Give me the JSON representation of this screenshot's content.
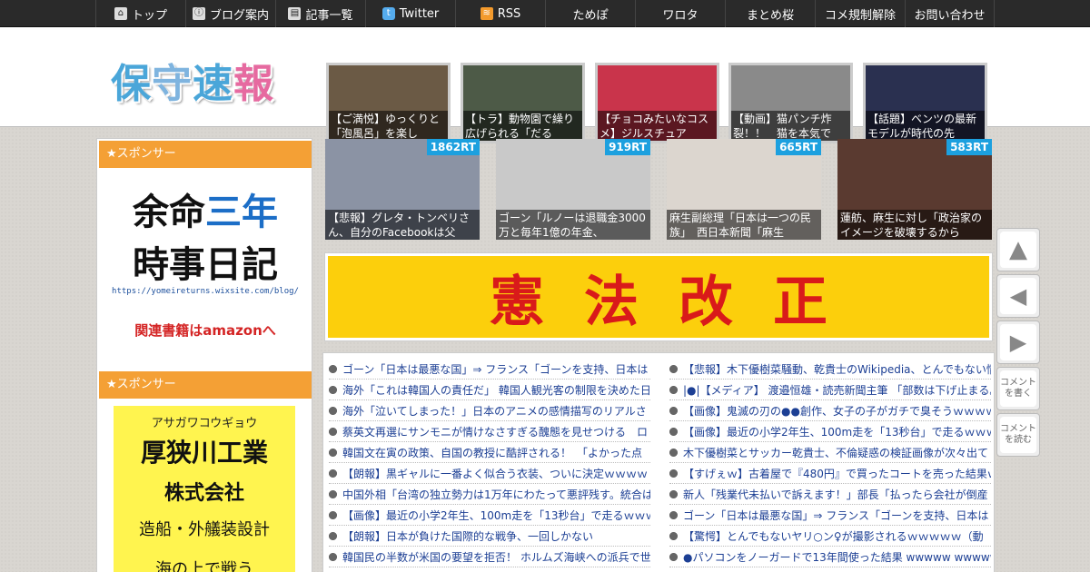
{
  "nav": [
    {
      "label": "トップ",
      "icon": "home-icon",
      "glyph": "⌂"
    },
    {
      "label": "ブログ案内",
      "icon": "info-icon",
      "glyph": "ⓘ"
    },
    {
      "label": "記事一覧",
      "icon": "list-icon",
      "glyph": "▤"
    },
    {
      "label": "Twitter",
      "icon": "twitter-icon",
      "glyph": "t"
    },
    {
      "label": "RSS",
      "icon": "rss-icon",
      "glyph": "≋"
    },
    {
      "label": "ためぽ",
      "icon": "",
      "glyph": ""
    },
    {
      "label": "ワロタ",
      "icon": "",
      "glyph": ""
    },
    {
      "label": "まとめ桜",
      "icon": "",
      "glyph": ""
    },
    {
      "label": "コメ規制解除",
      "icon": "",
      "glyph": ""
    },
    {
      "label": "お問い合わせ",
      "icon": "",
      "glyph": ""
    }
  ],
  "logo": {
    "chars": [
      "保",
      "守",
      "速",
      "報"
    ]
  },
  "featured": [
    {
      "caption": "【ご満悦】ゆっくりと「泡風呂」を楽し",
      "color": "#6b5a45"
    },
    {
      "caption": "【トラ】動物園で繰り広げられる「だる",
      "color": "#4d5a47"
    },
    {
      "caption": "【チョコみたいなコスメ】ジルスチュア",
      "color": "#c9344b"
    },
    {
      "caption": "【動画】猫パンチ炸裂！！　猫を本気で",
      "color": "#8a8a8a"
    },
    {
      "caption": "【話題】ベンツの最新モデルが時代の先",
      "color": "#2a3050"
    }
  ],
  "sidebar": {
    "sponsor1": "★スポンサー",
    "sponsor2": "★スポンサー",
    "ad1": {
      "line1a": "余命",
      "line1b": "三年",
      "line2": "時事日記",
      "url": "https://yomeireturns.wixsite.com/blog/",
      "amazon": "関連書籍はamazonへ"
    },
    "ad2": {
      "kana": "アサガワコウギョウ",
      "name": "厚狭川工業",
      "corp": "株式会社",
      "biz": "造船・外艤装設計",
      "more": "海の上で戦う"
    }
  },
  "retweets": [
    {
      "badge": "1862RT",
      "caption": "【悲報】グレタ・トンベリさん、自分のFacebookは父",
      "color": "#8b93a4"
    },
    {
      "badge": "919RT",
      "caption": "ゴーン「ルノーは退職金3000万と毎年1億の年金、",
      "color": "#c9c9c9"
    },
    {
      "badge": "665RT",
      "caption": "麻生副総理「日本は一つの民族」　西日本新聞「麻生",
      "color": "#dcd6cf"
    },
    {
      "badge": "583RT",
      "caption": "蓮舫、麻生に対し「政治家のイメージを破壊するから",
      "color": "#5a3a30"
    }
  ],
  "banner": {
    "chars": [
      "憲",
      "法",
      "改",
      "正"
    ]
  },
  "news_left": [
    "ゴーン「日本は最悪な国」⇒ フランス「ゴーンを支持、日本は",
    "海外「これは韓国人の責任だ」 韓国人観光客の制限を決めた日",
    "海外「泣いてしまった！」日本のアニメの感情描写のリアルさ",
    "蔡英文再選にサンモニが情けなさすぎる醜態を見せつける　ロ",
    "韓国文在寅の政策、自国の教授に酷評される！　「よかった点",
    "【朗報】黒ギャルに一番よく似合う衣装、ついに決定ｗｗｗｗ",
    "中国外相「台湾の独立勢力は1万年にわたって悪評残す。統合は",
    "【画像】最近の小学2年生、100m走を「13秒台」で走るｗｗｗ",
    "【朗報】日本が負けた国際的な戦争、一回しかない",
    "韓国民の半数が米国の要望を拒否！ ホルムズ海峡への派兵で世"
  ],
  "news_right": [
    "【悲報】木下優樹菜騒動、乾貴士のWikipedia、とんでもない情",
    "|●|【メディア】 渡邉恒雄・読売新聞主筆 「部数は下げ止まる。",
    "【画像】鬼滅の刃の●●創作、女子の子がガチで臭そうｗｗｗｗ",
    "【画像】最近の小学2年生、100m走を「13秒台」で走るｗｗｗ",
    "木下優樹菜とサッカー乾貴士、不倫疑惑の検証画像が次々出て",
    "【すげぇｗ】古着屋で『480円』で買ったコートを売った結果ｗ",
    "新人「残業代未払いで訴えます！」部長「払ったら会社が倒産",
    "ゴーン「日本は最悪な国」⇒ フランス「ゴーンを支持、日本は",
    "【驚愕】とんでもないヤリ○ン♀が撮影されるｗｗｗｗｗ（動",
    "●パソコンをノーガードで13年間使った結果 wwwww wwwww wwww"
  ],
  "side_buttons": {
    "up": "▲",
    "back": "◀",
    "forward": "▶",
    "comment_write": "コメントを書く",
    "comment_read": "コメントを読む"
  }
}
